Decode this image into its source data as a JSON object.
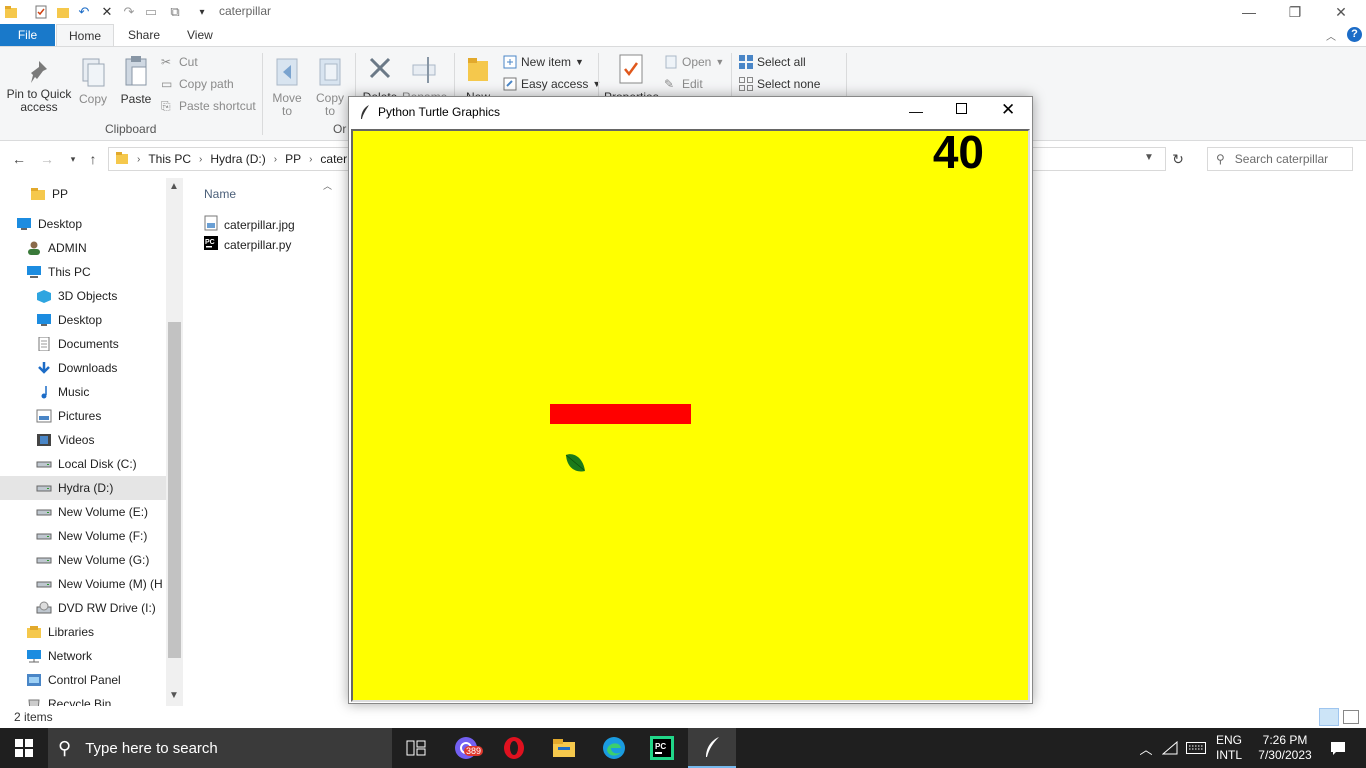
{
  "explorer": {
    "window_title": "caterpillar",
    "tabs": [
      "File",
      "Home",
      "Share",
      "View"
    ],
    "ribbon": {
      "clipboard": {
        "pin": "Pin to Quick access",
        "copy": "Copy",
        "paste": "Paste",
        "cut": "Cut",
        "copy_path": "Copy path",
        "paste_shortcut": "Paste shortcut",
        "label": "Clipboard"
      },
      "organize": {
        "move_to": "Move to",
        "copy_to": "Copy to",
        "delete": "Delete",
        "rename": "Rename",
        "label": "Or"
      },
      "new": {
        "new_folder": "New",
        "new_item": "New item",
        "easy_access": "Easy access"
      },
      "open": {
        "properties": "Properties",
        "open": "Open",
        "edit": "Edit"
      },
      "select": {
        "select_all": "Select all",
        "select_none": "Select none"
      }
    },
    "address": {
      "crumbs": [
        "This PC",
        "Hydra (D:)",
        "PP",
        "cater"
      ]
    },
    "search": {
      "placeholder": "Search caterpillar"
    },
    "nav_pane": {
      "items": [
        {
          "label": "PP",
          "icon": "folder-icon"
        },
        {
          "label": "Desktop",
          "icon": "desktop-icon"
        },
        {
          "label": "ADMIN",
          "icon": "user-icon"
        },
        {
          "label": "This PC",
          "icon": "computer-icon"
        },
        {
          "label": "3D Objects",
          "icon": "cube-icon"
        },
        {
          "label": "Desktop",
          "icon": "desktop-icon"
        },
        {
          "label": "Documents",
          "icon": "document-icon"
        },
        {
          "label": "Downloads",
          "icon": "download-icon"
        },
        {
          "label": "Music",
          "icon": "music-icon"
        },
        {
          "label": "Pictures",
          "icon": "picture-icon"
        },
        {
          "label": "Videos",
          "icon": "video-icon"
        },
        {
          "label": "Local Disk (C:)",
          "icon": "drive-icon"
        },
        {
          "label": "Hydra (D:)",
          "icon": "drive-icon"
        },
        {
          "label": "New Volume (E:)",
          "icon": "drive-icon"
        },
        {
          "label": "New Volume (F:)",
          "icon": "drive-icon"
        },
        {
          "label": "New Volume (G:)",
          "icon": "drive-icon"
        },
        {
          "label": "New Voiume (M) (H",
          "icon": "drive-icon"
        },
        {
          "label": "DVD RW Drive (I:)",
          "icon": "dvd-icon"
        },
        {
          "label": "Libraries",
          "icon": "library-icon"
        },
        {
          "label": "Network",
          "icon": "network-icon"
        },
        {
          "label": "Control Panel",
          "icon": "control-panel-icon"
        },
        {
          "label": "Recycle Bin",
          "icon": "recycle-bin-icon"
        }
      ]
    },
    "file_list": {
      "column_name": "Name",
      "files": [
        {
          "name": "caterpillar.jpg",
          "icon": "image-file-icon"
        },
        {
          "name": "caterpillar.py",
          "icon": "pycharm-file-icon"
        }
      ]
    },
    "status": {
      "count": "2 items"
    }
  },
  "turtle_window": {
    "title": "Python Turtle Graphics",
    "score": "40",
    "colors": {
      "background": "#ffff00",
      "caterpillar": "#ff0000",
      "leaf": "#1a7a1a"
    }
  },
  "taskbar": {
    "search_placeholder": "Type here to search",
    "viber_badge": "389",
    "lang_top": "ENG",
    "lang_bottom": "INTL",
    "time": "7:26 PM",
    "date": "7/30/2023"
  }
}
